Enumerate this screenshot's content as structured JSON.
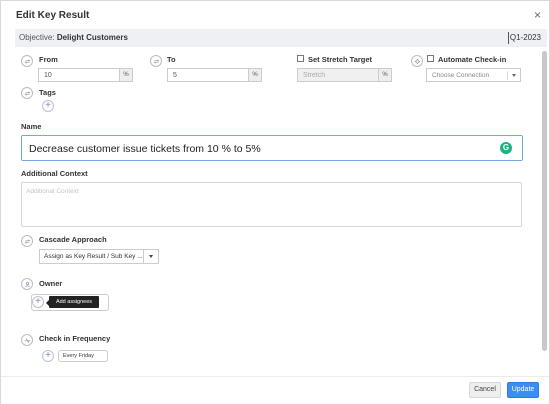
{
  "header": {
    "title": "Edit Key Result",
    "close_label": "×"
  },
  "objective": {
    "label": "Objective:",
    "value": "Delight Customers",
    "quarter": "Q1-2023"
  },
  "from": {
    "label": "From",
    "value": "10",
    "suffix": "%"
  },
  "to": {
    "label": "To",
    "value": "5",
    "suffix": "%"
  },
  "stretch": {
    "label": "Set Stretch Target",
    "placeholder": "Stretch",
    "suffix": "%"
  },
  "checkin": {
    "label": "Automate Check-in",
    "select_value": "Choose Connection"
  },
  "tags": {
    "label": "Tags"
  },
  "name": {
    "label": "Name",
    "value": "Decrease customer issue tickets from 10 % to 5%"
  },
  "context": {
    "label": "Additional Context",
    "placeholder": "Additional Context"
  },
  "cascade": {
    "label": "Cascade Approach",
    "value": "Assign as Key Result / Sub Key ..."
  },
  "owner": {
    "label": "Owner",
    "tooltip": "Add assignees"
  },
  "frequency": {
    "label": "Check in Frequency",
    "value": "Every Friday"
  },
  "footer": {
    "cancel_label": "Cancel",
    "update_label": "Update"
  },
  "colors": {
    "accent": "#3b8ef2",
    "focus_border": "#76a6df",
    "grammarly": "#15b685",
    "objective_bg": "#eef0f5"
  }
}
